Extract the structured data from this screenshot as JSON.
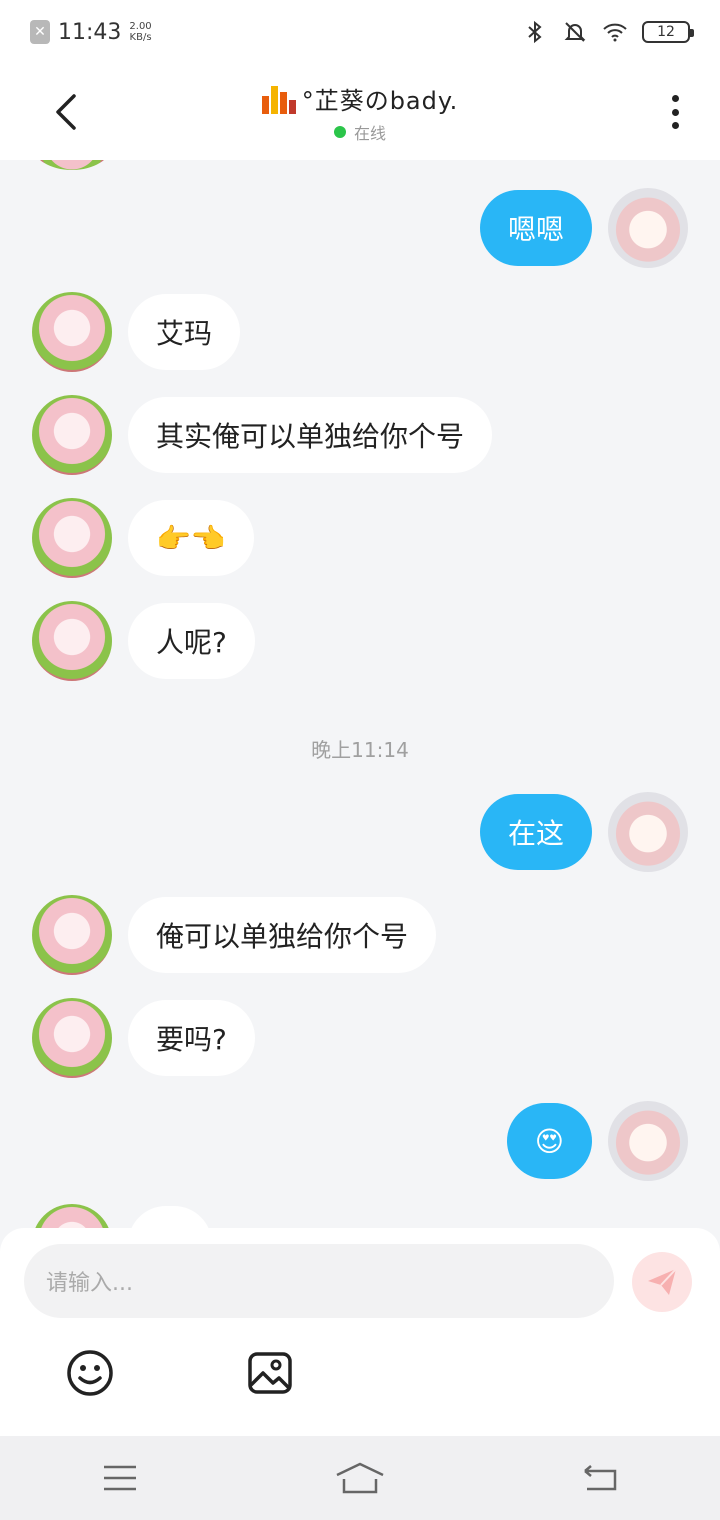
{
  "statusbar": {
    "time": "11:43",
    "speed_top": "2.00",
    "speed_bottom": "KB/s",
    "battery": "12"
  },
  "header": {
    "title": "°芷葵のbady.",
    "status": "在线"
  },
  "messages": [
    {
      "side": "right",
      "text": "嗯嗯"
    },
    {
      "side": "left",
      "text": "艾玛"
    },
    {
      "side": "left",
      "text": "其实俺可以单独给你个号"
    },
    {
      "side": "left",
      "text": "👉👈"
    },
    {
      "side": "left",
      "text": "人呢?"
    },
    {
      "side": "right",
      "text": "在这"
    },
    {
      "side": "left",
      "text": "俺可以单独给你个号"
    },
    {
      "side": "left",
      "text": "要吗?"
    },
    {
      "side": "right",
      "text": "😍"
    }
  ],
  "time_divider": "晚上11:14",
  "input": {
    "placeholder": "请输入..."
  },
  "colors": {
    "accent": "#29b6f6",
    "online": "#2bc54a",
    "send_button": "#fde3e3"
  },
  "icons": [
    "back-arrow-icon",
    "more-vertical-icon",
    "send-icon",
    "emoji-icon",
    "image-icon",
    "menu-icon",
    "home-icon",
    "back-icon"
  ]
}
